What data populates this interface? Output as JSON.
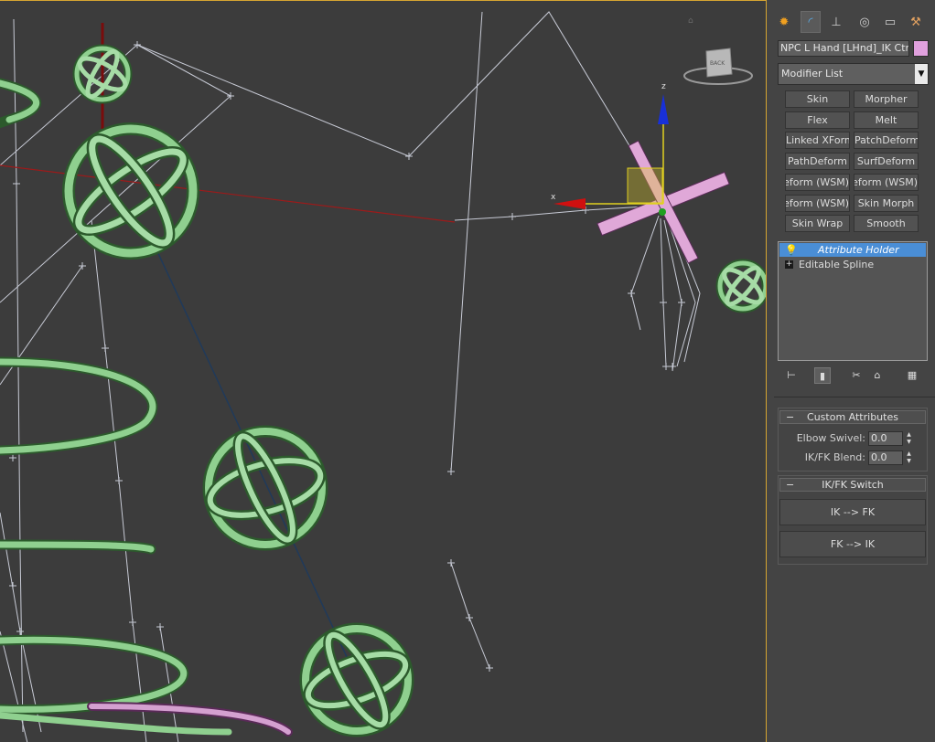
{
  "panel": {
    "tabs": [
      {
        "name": "create-tab",
        "icon": "sun-icon",
        "glyph": "✹"
      },
      {
        "name": "modify-tab",
        "icon": "modify-arc-icon",
        "glyph": "◜"
      },
      {
        "name": "hierarchy-tab",
        "icon": "hierarchy-icon",
        "glyph": "⊥"
      },
      {
        "name": "motion-tab",
        "icon": "motion-icon",
        "glyph": "◎"
      },
      {
        "name": "display-tab",
        "icon": "display-monitor-icon",
        "glyph": "▭"
      },
      {
        "name": "utilities-tab",
        "icon": "hammer-icon",
        "glyph": "⚒"
      }
    ],
    "object_name": "NPC L Hand [LHnd]_IK Ctrl_F",
    "object_color": "#e1a1de",
    "modifier_list_label": "Modifier List",
    "modifier_buttons": [
      "Skin",
      "Morpher",
      "Flex",
      "Melt",
      "Linked XForm",
      "PatchDeform",
      "PathDeform",
      "SurfDeform",
      "PatchDeform (WSM)",
      "PathDeform (WSM)",
      "SurfDeform (WSM)",
      "Skin Morph",
      "Skin Wrap",
      "Smooth"
    ],
    "stack": [
      {
        "label": "Attribute Holder",
        "selected": true,
        "icon": "lightbulb-icon"
      },
      {
        "label": "Editable Spline",
        "selected": false,
        "icon": "expand-plus-icon"
      }
    ],
    "stack_tools": [
      {
        "name": "pin-stack-icon",
        "glyph": "⊢"
      },
      {
        "name": "show-end-result-icon",
        "glyph": "▮"
      },
      {
        "name": "make-unique-icon",
        "glyph": "✂"
      },
      {
        "name": "remove-modifier-icon",
        "glyph": "🗑"
      },
      {
        "name": "configure-sets-icon",
        "glyph": "▦"
      }
    ],
    "rollouts": {
      "custom_attributes": {
        "title": "Custom Attributes",
        "fields": [
          {
            "label": "Elbow Swivel:",
            "value": "0.0"
          },
          {
            "label": "IK/FK Blend:",
            "value": "0.0"
          }
        ]
      },
      "ikfk_switch": {
        "title": "IK/FK Switch",
        "buttons": [
          "IK --> FK",
          "FK --> IK"
        ]
      }
    }
  },
  "viewport": {
    "viewcube_label": "BACK",
    "gizmo_axes": {
      "x": "x",
      "z": "z"
    },
    "gizmo_colors": {
      "x": "#d01010",
      "y": "#e0d020",
      "z": "#1830d8"
    },
    "control_color": "#8fd08f",
    "selected_color": "#e0a8d8"
  }
}
